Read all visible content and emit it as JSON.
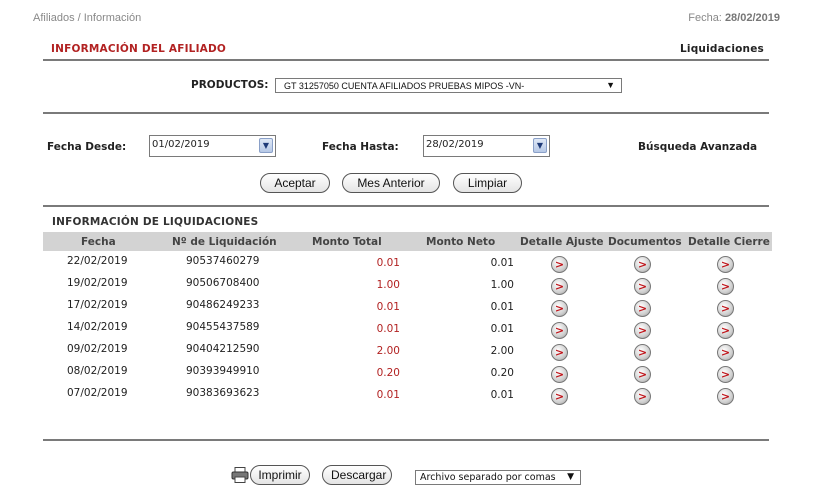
{
  "breadcrumb": "Afiliados / Información",
  "header": {
    "date_label": "Fecha:",
    "date_value": "28/02/2019"
  },
  "affiliate": {
    "title": "INFORMACIÓN DEL AFILIADO",
    "link": "Liquidaciones"
  },
  "products": {
    "label": "PRODUCTOS:",
    "selected": "GT 31257050 CUENTA AFILIADOS PRUEBAS MIPOS -VN-"
  },
  "filters": {
    "from_label": "Fecha Desde:",
    "from_value": "01/02/2019",
    "to_label": "Fecha Hasta:",
    "to_value": "28/02/2019",
    "advanced": "Búsqueda Avanzada"
  },
  "buttons": {
    "accept": "Aceptar",
    "prev_month": "Mes Anterior",
    "clear": "Limpiar"
  },
  "settlements": {
    "title": "INFORMACIÓN DE LIQUIDACIONES",
    "columns": [
      "Fecha",
      "Nº de Liquidación",
      "Monto Total",
      "Monto Neto",
      "Detalle Ajuste",
      "Documentos",
      "Detalle Cierre"
    ],
    "rows": [
      {
        "fecha": "22/02/2019",
        "numero": "90537460279",
        "total": "0.01",
        "neto": "0.01"
      },
      {
        "fecha": "19/02/2019",
        "numero": "90506708400",
        "total": "1.00",
        "neto": "1.00"
      },
      {
        "fecha": "17/02/2019",
        "numero": "90486249233",
        "total": "0.01",
        "neto": "0.01"
      },
      {
        "fecha": "14/02/2019",
        "numero": "90455437589",
        "total": "0.01",
        "neto": "0.01"
      },
      {
        "fecha": "09/02/2019",
        "numero": "90404212590",
        "total": "2.00",
        "neto": "2.00"
      },
      {
        "fecha": "08/02/2019",
        "numero": "90393949910",
        "total": "0.20",
        "neto": "0.20"
      },
      {
        "fecha": "07/02/2019",
        "numero": "90383693623",
        "total": "0.01",
        "neto": "0.01"
      }
    ],
    "action_glyph": ">"
  },
  "footer": {
    "print": "Imprimir",
    "download": "Descargar",
    "format": "Archivo separado por comas"
  },
  "colors": {
    "accent_red": "#b22222",
    "header_bar": "#d3d3d3"
  },
  "icons": {
    "calendar": "calendar-dropdown-icon",
    "printer": "printer-icon",
    "dropdown": "chevron-down-icon",
    "go": "arrow-right-circle-icon"
  }
}
